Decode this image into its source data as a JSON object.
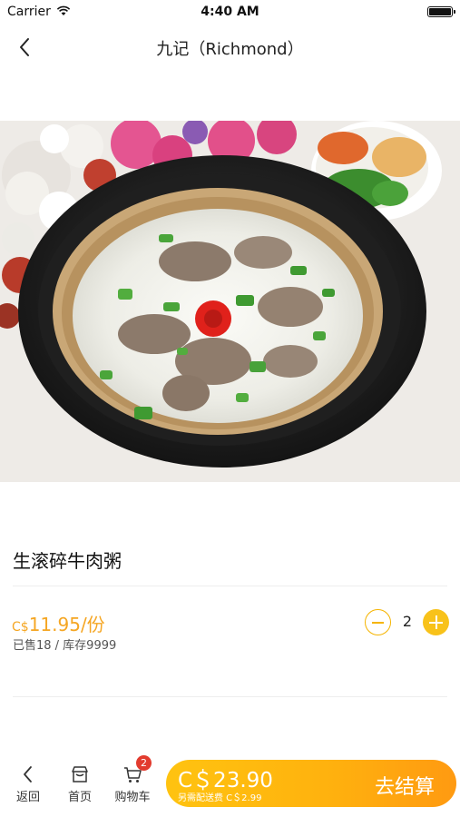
{
  "status_bar": {
    "carrier": "Carrier",
    "time": "4:40 AM"
  },
  "nav": {
    "title": "九记（Richmond）"
  },
  "product": {
    "name": "生滚碎牛肉粥",
    "currency": "C$",
    "price": "11.95/份",
    "sales": "已售18 / 库存9999",
    "quantity": "2"
  },
  "tabbar": {
    "back_label": "返回",
    "home_label": "首页",
    "cart_label": "购物车",
    "cart_badge": "2"
  },
  "checkout": {
    "total": "C＄23.90",
    "delivery_note": "另需配送费 C＄2.99",
    "button_label": "去结算"
  },
  "colors": {
    "accent": "#f5a623",
    "checkout_gradient_start": "#ffc310",
    "checkout_gradient_end": "#ff9a11",
    "badge": "#e23b2e"
  },
  "icons": [
    "wifi-icon",
    "battery-icon",
    "back-chevron-icon",
    "store-icon",
    "cart-icon",
    "minus-icon",
    "plus-icon"
  ]
}
